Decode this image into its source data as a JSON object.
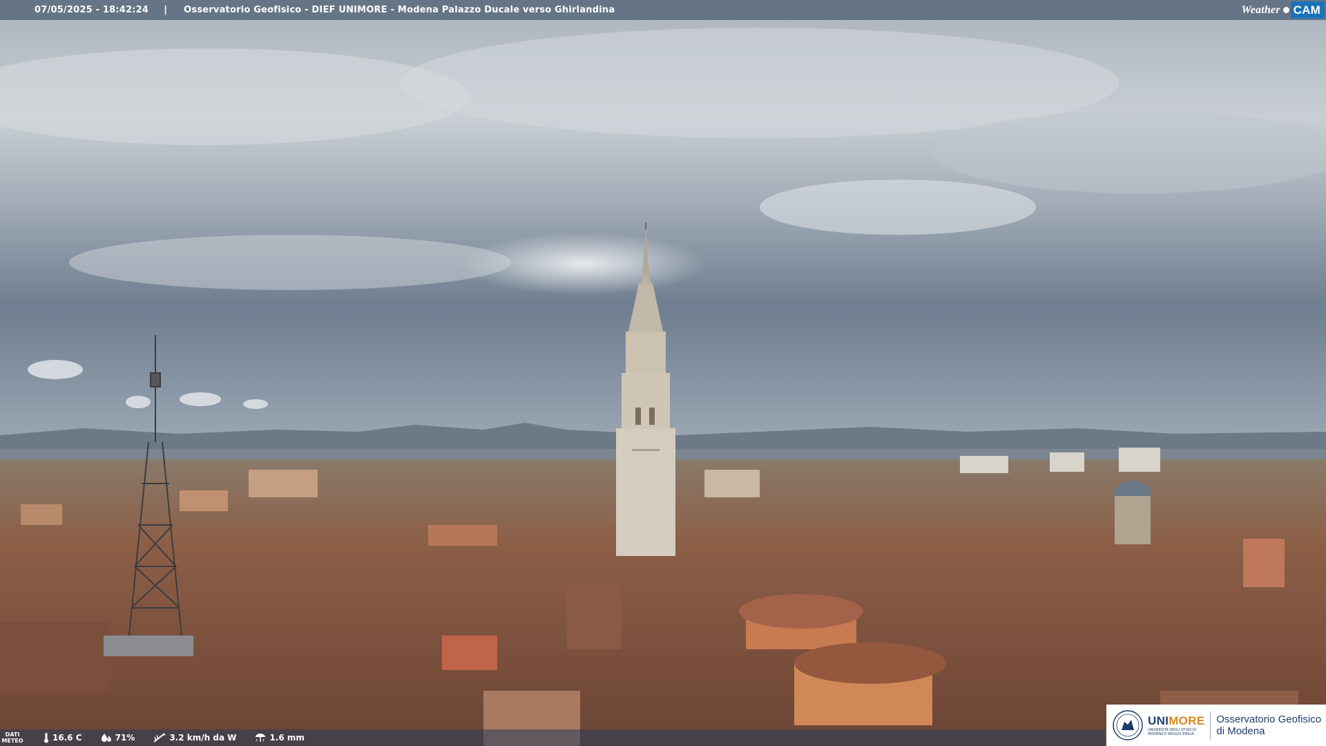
{
  "header": {
    "timestamp": "07/05/2025 - 18:42:24",
    "separator": "|",
    "title": "Osservatorio Geofisico - DIEF UNIMORE - Modena Palazzo Ducale verso Ghirlandina",
    "logo_weather": "Weather",
    "logo_cam": "CAM"
  },
  "weather": {
    "label_line1": "DATI",
    "label_line2": "METEO",
    "temperature": "16.6 C",
    "humidity": "71%",
    "wind": "3.2 km/h da W",
    "rain": "1.6 mm"
  },
  "branding": {
    "name_part1": "UNI",
    "name_part2": "MORE",
    "sub_line1": "UNIVERSITÀ DEGLI STUDI DI",
    "sub_line2": "MODENA E REGGIO EMILIA",
    "observatory_line1": "Osservatorio Geofisico",
    "observatory_line2": "di Modena"
  },
  "colors": {
    "topbar": "#607080",
    "cam_badge": "#1a73b8",
    "unimore_blue": "#1a3d6d",
    "unimore_orange": "#d88a1e"
  }
}
